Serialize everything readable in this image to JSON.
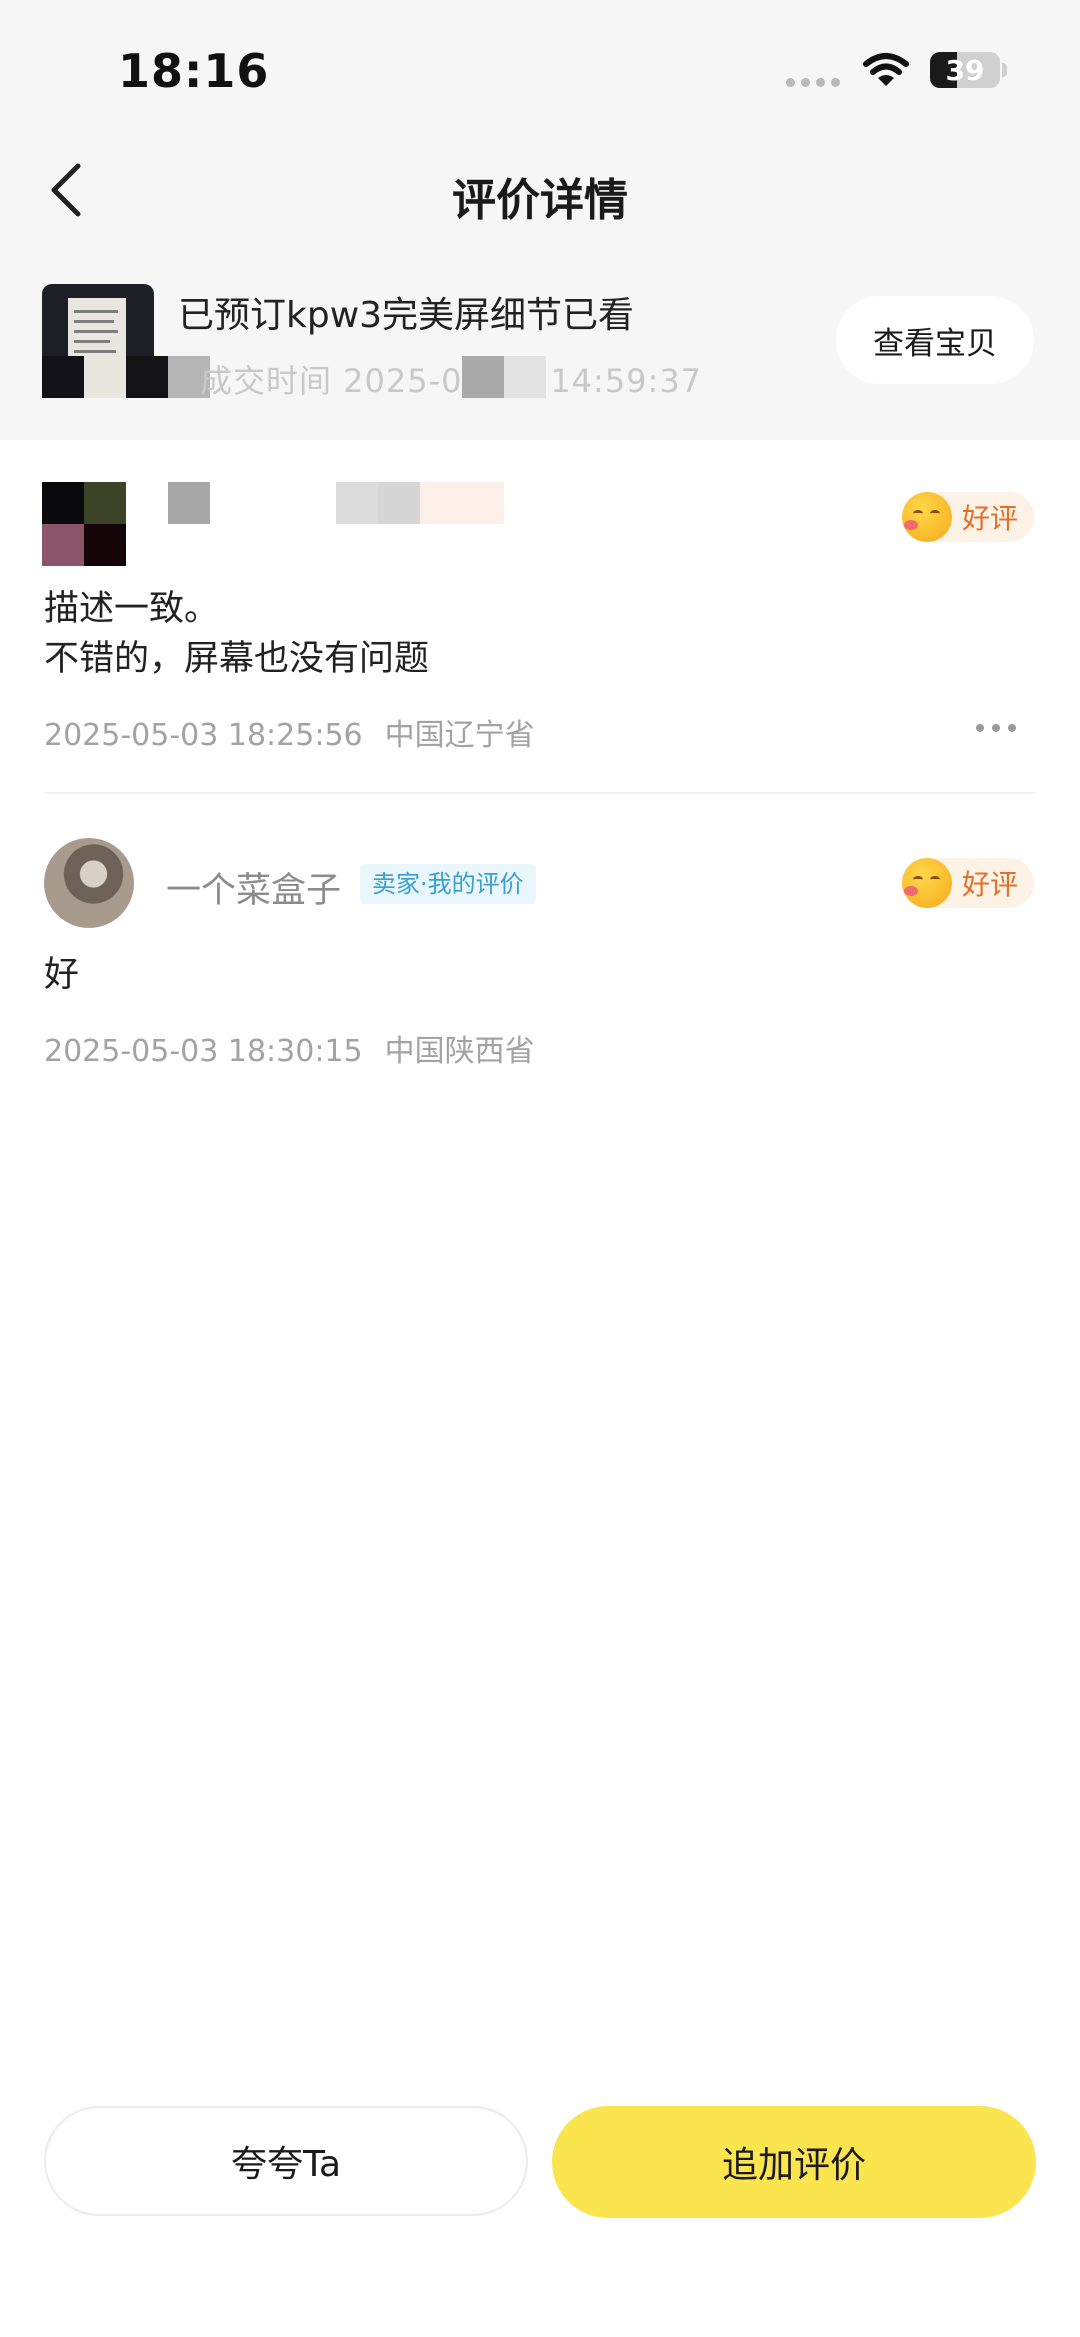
{
  "status_bar": {
    "time": "18:16",
    "battery": "39"
  },
  "header": {
    "title": "评价详情"
  },
  "item": {
    "title": "已预订kpw3完美屏细节已看",
    "subtitle": "成交时间 2025-05-02 14:59:37",
    "view_button": "查看宝贝"
  },
  "reviews": [
    {
      "badge": "好评",
      "text_line1": "描述一致。",
      "text_line2": "不错的，屏幕也没有问题",
      "time": "2025-05-03 18:25:56",
      "location": "中国辽宁省"
    },
    {
      "name": "一个菜盒子",
      "tag": "卖家·我的评价",
      "badge": "好评",
      "text_line1": "好",
      "time": "2025-05-03 18:30:15",
      "location": "中国陕西省"
    }
  ],
  "actions": {
    "praise": "夸夸Ta",
    "append": "追加评价"
  },
  "colors": {
    "accent": "#fbe54e",
    "badge_text": "#e0702a",
    "tag_text": "#3a9fd1"
  }
}
